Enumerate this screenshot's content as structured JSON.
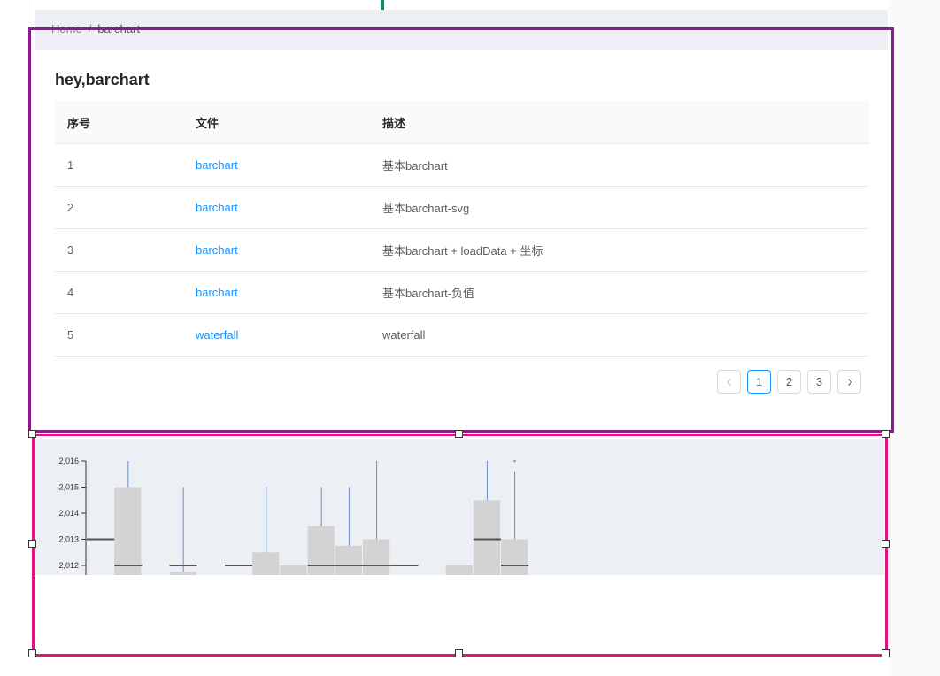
{
  "breadcrumb": {
    "home": "Home",
    "separator": "/",
    "current": "barchart"
  },
  "page_title": "hey,barchart",
  "table": {
    "columns": [
      "序号",
      "文件",
      "描述"
    ],
    "rows": [
      {
        "idx": "1",
        "file": "barchart",
        "desc": "基本barchart"
      },
      {
        "idx": "2",
        "file": "barchart",
        "desc": "基本barchart-svg"
      },
      {
        "idx": "3",
        "file": "barchart",
        "desc": "基本barchart + loadData + 坐标"
      },
      {
        "idx": "4",
        "file": "barchart",
        "desc": "基本barchart-负值"
      },
      {
        "idx": "5",
        "file": "waterfall",
        "desc": "waterfall"
      }
    ]
  },
  "pagination": {
    "pages": [
      "1",
      "2",
      "3"
    ],
    "current": "1"
  },
  "colors": {
    "link": "#1890ff",
    "purple_selection": "#8b1a8b",
    "pink_selection": "#e0157f",
    "bar_fill": "#d3d3d3",
    "whisker": "#6a8fc7",
    "median": "#555555"
  },
  "chart_data": {
    "type": "bar",
    "ylim": [
      2011.7,
      2016
    ],
    "yticks": [
      "2,012",
      "2,013",
      "2,014",
      "2,015",
      "2,016"
    ],
    "ytick_values": [
      2012,
      2013,
      2014,
      2015,
      2016
    ],
    "boxes": [
      {
        "slot": 0,
        "top": null,
        "median": 2013,
        "whisker": null
      },
      {
        "slot": 1,
        "top": 2015,
        "median": 2012,
        "whisker": 2016
      },
      {
        "slot": 3,
        "top": 2011.75,
        "median": 2012,
        "whisker": 2015
      },
      {
        "slot": 5,
        "top": null,
        "median": 2012,
        "whisker": null
      },
      {
        "slot": 6,
        "top": 2012.5,
        "median": null,
        "whisker": 2015
      },
      {
        "slot": 7,
        "top": 2012,
        "median": null,
        "whisker": null
      },
      {
        "slot": 8,
        "top": 2013.5,
        "median": 2012,
        "whisker": 2015
      },
      {
        "slot": 9,
        "top": 2012.75,
        "median": 2012,
        "whisker": 2015
      },
      {
        "slot": 10,
        "top": 2013,
        "median": 2012,
        "whisker": 2016
      },
      {
        "slot": 11,
        "top": null,
        "median": 2012,
        "whisker": null
      },
      {
        "slot": 13,
        "top": 2012,
        "median": null,
        "whisker": null
      },
      {
        "slot": 14,
        "top": 2014.5,
        "median": 2013,
        "whisker": 2016
      },
      {
        "slot": 15,
        "top": 2013,
        "median": 2012,
        "whisker": 2015.6
      }
    ]
  }
}
